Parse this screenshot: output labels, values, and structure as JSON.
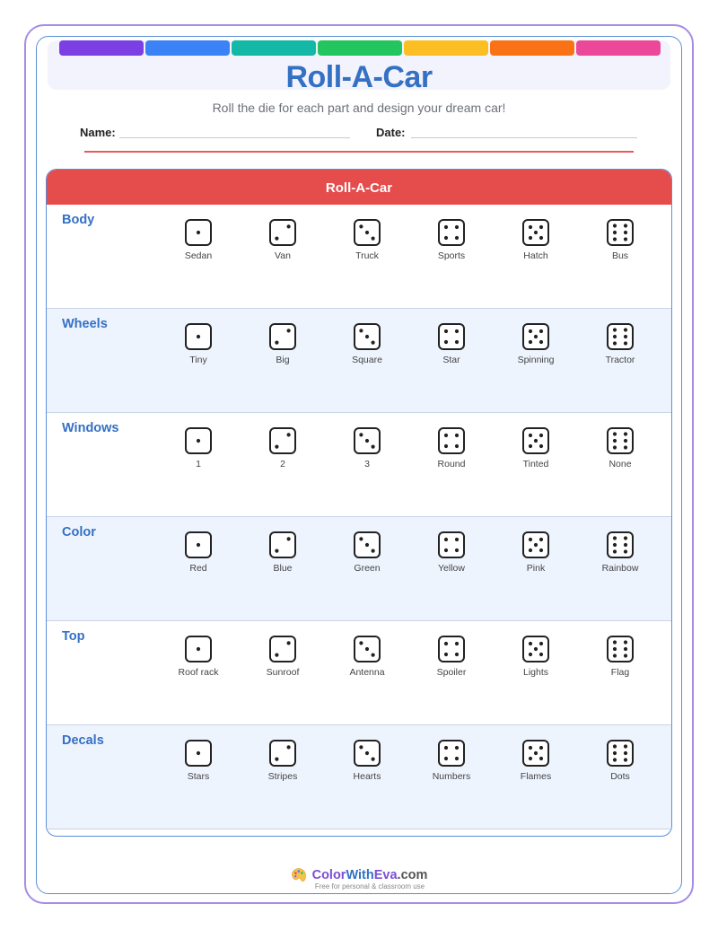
{
  "header": {
    "strip_colors": [
      "#7b3fe4",
      "#3b82f6",
      "#14b8a6",
      "#22c55e",
      "#fbbf24",
      "#f97316",
      "#ec4899"
    ],
    "title": "Roll-A-Car",
    "subtitle": "Roll the die for each part and design your dream car!",
    "name_label": "Name:",
    "date_label": "Date:"
  },
  "table": {
    "title": "Roll-A-Car",
    "rows": [
      {
        "category": "Body",
        "options": [
          "Sedan",
          "Van",
          "Truck",
          "Sports",
          "Hatch",
          "Bus"
        ]
      },
      {
        "category": "Wheels",
        "options": [
          "Tiny",
          "Big",
          "Square",
          "Star",
          "Spinning",
          "Tractor"
        ]
      },
      {
        "category": "Windows",
        "options": [
          "1",
          "2",
          "3",
          "Round",
          "Tinted",
          "None"
        ]
      },
      {
        "category": "Color",
        "options": [
          "Red",
          "Blue",
          "Green",
          "Yellow",
          "Pink",
          "Rainbow"
        ]
      },
      {
        "category": "Top",
        "options": [
          "Roof rack",
          "Sunroof",
          "Antenna",
          "Spoiler",
          "Lights",
          "Flag"
        ]
      },
      {
        "category": "Decals",
        "options": [
          "Stars",
          "Stripes",
          "Hearts",
          "Numbers",
          "Flames",
          "Dots"
        ]
      }
    ]
  },
  "footer": {
    "brand_part1": "Color",
    "brand_part2": "With",
    "brand_part3": "Eva",
    "brand_part4": ".com",
    "tagline": "Free for personal & classroom use",
    "logo_icon": "palette-icon"
  }
}
